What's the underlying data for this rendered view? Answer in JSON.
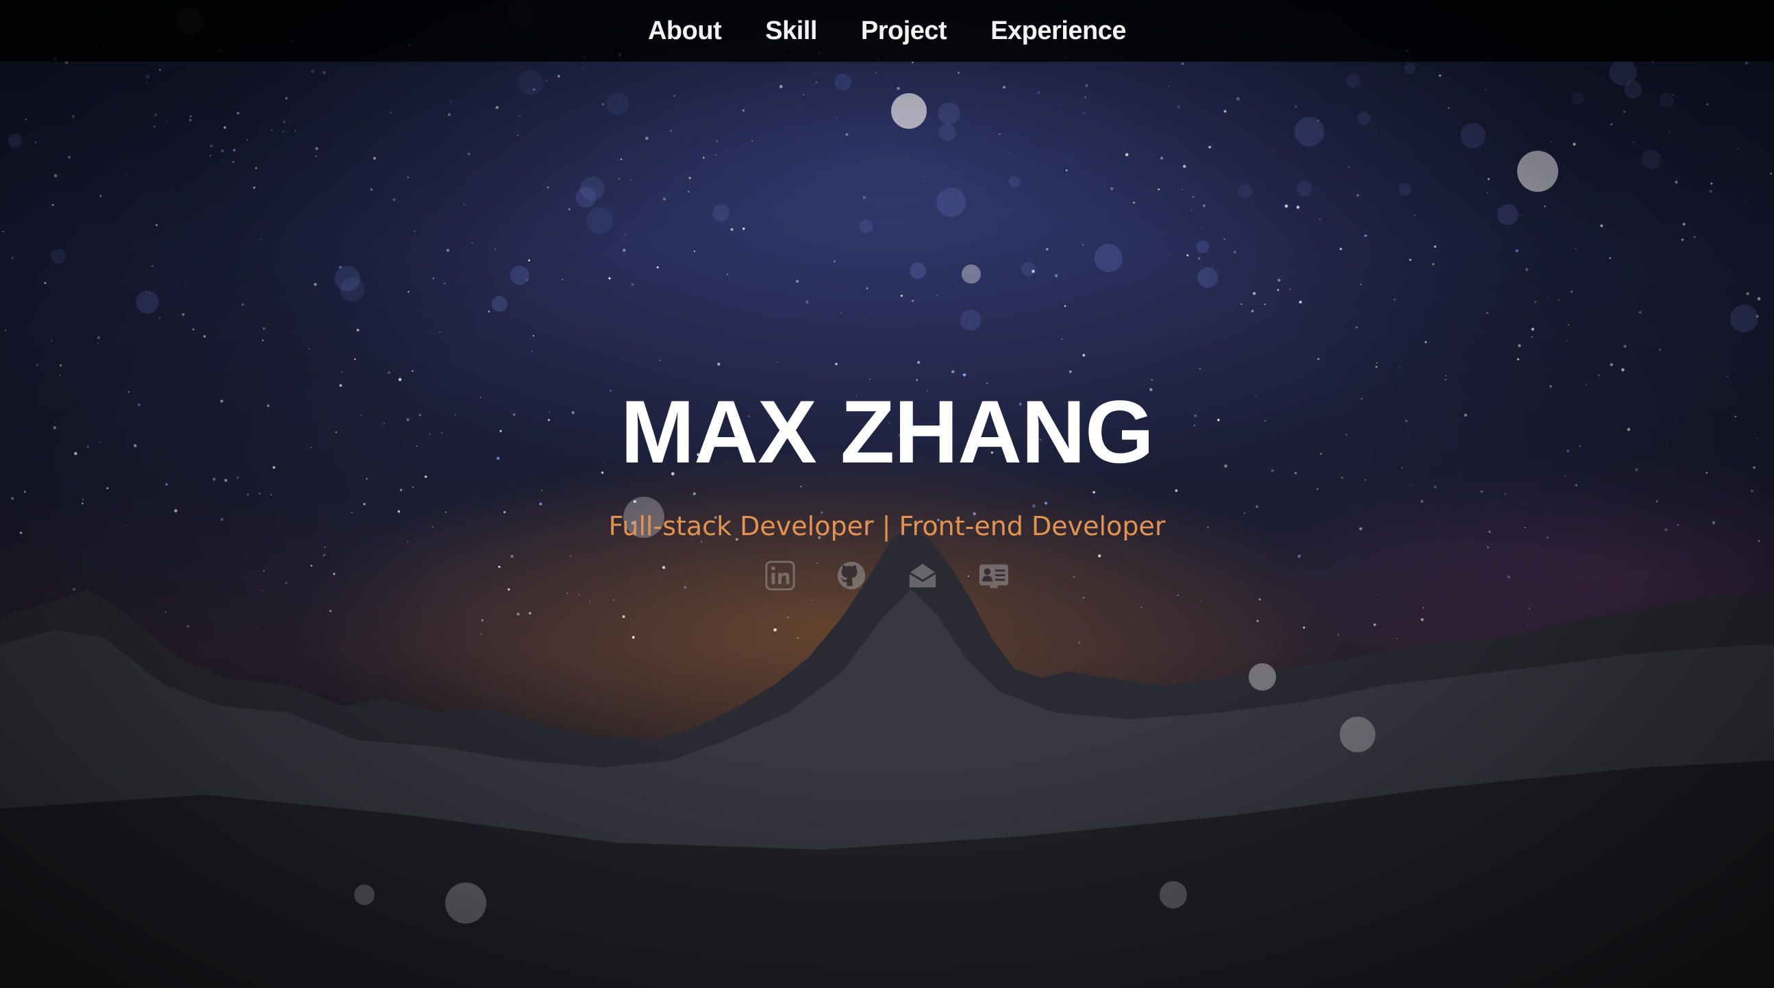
{
  "nav": {
    "items": [
      {
        "label": "About"
      },
      {
        "label": "Skill"
      },
      {
        "label": "Project"
      },
      {
        "label": "Experience"
      }
    ]
  },
  "hero": {
    "name": "MAX ZHANG",
    "subtitle": "Full-stack Developer | Front-end Developer",
    "subtitle_color": "#e39252"
  },
  "socials": [
    {
      "icon": "linkedin-icon"
    },
    {
      "icon": "github-icon"
    },
    {
      "icon": "email-icon"
    },
    {
      "icon": "resume-card-icon"
    }
  ],
  "colors": {
    "nav_background": "#000000",
    "title": "#ffffff",
    "accent": "#e39252"
  }
}
